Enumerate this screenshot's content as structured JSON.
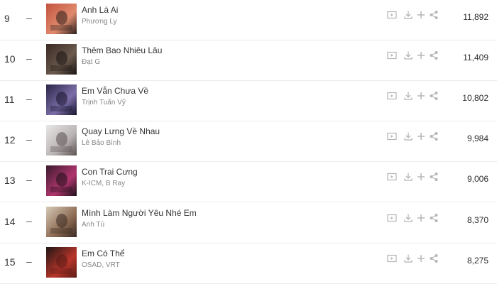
{
  "songs": [
    {
      "rank": "9",
      "change": "–",
      "title": "Anh Là Ai",
      "artist": "Phương Ly",
      "views": "11,892",
      "cover_colors": [
        "#c2533f",
        "#e08a6e",
        "#2a1f1c"
      ]
    },
    {
      "rank": "10",
      "change": "–",
      "title": "Thêm Bao Nhiêu Lâu",
      "artist": "Đạt G",
      "views": "11,409",
      "cover_colors": [
        "#3a2a24",
        "#6b5a4d",
        "#1a1412"
      ]
    },
    {
      "rank": "11",
      "change": "–",
      "title": "Em Vẫn Chưa Về",
      "artist": "Trịnh Tuấn Vỹ",
      "views": "10,802",
      "cover_colors": [
        "#2b2547",
        "#7c6fa8",
        "#15122a"
      ]
    },
    {
      "rank": "12",
      "change": "–",
      "title": "Quay Lưng Về Nhau",
      "artist": "Lê Bảo Bình",
      "views": "9,984",
      "cover_colors": [
        "#e8e6e6",
        "#b9b3b3",
        "#5a5050"
      ]
    },
    {
      "rank": "13",
      "change": "–",
      "title": "Con Trai Cưng",
      "artist": "K-ICM, B Ray",
      "views": "9,006",
      "cover_colors": [
        "#3a1a2e",
        "#b0366e",
        "#1c0f18"
      ]
    },
    {
      "rank": "14",
      "change": "–",
      "title": "Mình Làm Người Yêu Nhé Em",
      "artist": "Anh Tú",
      "views": "8,370",
      "cover_colors": [
        "#d6c9b8",
        "#8c6a52",
        "#3a2a22"
      ]
    },
    {
      "rank": "15",
      "change": "–",
      "title": "Em Có Thể",
      "artist": "OSAD, VRT",
      "views": "8,275",
      "cover_colors": [
        "#1f1616",
        "#b8352a",
        "#5a1a16"
      ]
    }
  ],
  "icons": {
    "mv": "mv-icon",
    "download": "download-icon",
    "add": "add-icon",
    "share": "share-icon"
  },
  "colors": {
    "icon": "#b5b5b5",
    "text": "#333333",
    "subtext": "#888888",
    "divider": "#ececec"
  }
}
